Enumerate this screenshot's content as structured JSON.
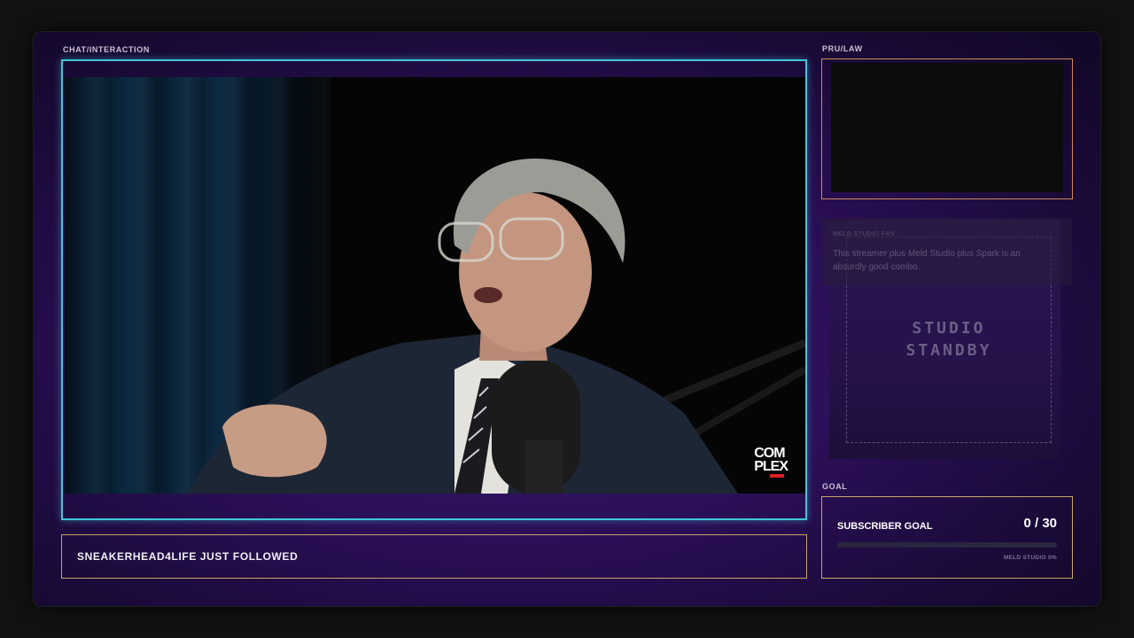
{
  "labels": {
    "chat_interaction": "CHAT/INTERACTION",
    "pru_law": "PRU/LAW",
    "goal": "GOAL"
  },
  "video": {
    "logo_line1": "COM",
    "logo_line2": "PLEX"
  },
  "alert": {
    "text": "SNEAKERHEAD4LIFE JUST FOLLOWED"
  },
  "fan_message": {
    "title": "MELD STUDIO FAN",
    "body": "This streamer plus Meld Studio plus Spark is an absurdly good combo."
  },
  "standby": {
    "line1": "STUDIO",
    "line2": "STANDBY"
  },
  "goal": {
    "title": "SUBSCRIBER GOAL",
    "count": "0 / 30",
    "progress_fraction": 0,
    "meta": "MELD STUDIO 0%"
  },
  "colors": {
    "accent_cyan": "#3fc6d8",
    "accent_gold": "#c7a765",
    "accent_orange": "#c98a59",
    "background_purple": "#2a0f55"
  }
}
